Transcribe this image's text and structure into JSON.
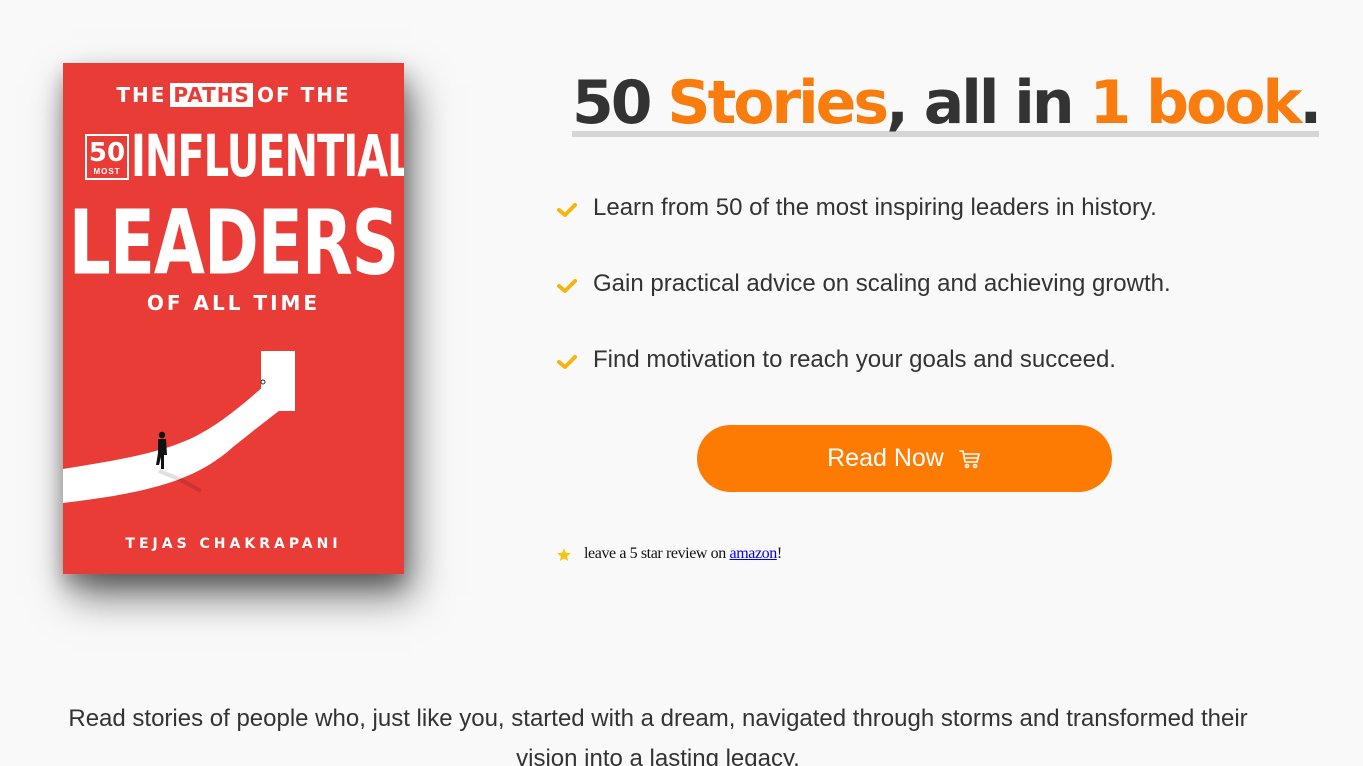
{
  "book": {
    "top_line_pre": "THE",
    "top_line_highlight": "PATHS",
    "top_line_post": "OF THE",
    "number": "50",
    "number_sub": "MOST",
    "line_influential": "INFLUENTIAL",
    "line_leaders": "LEADERS",
    "line_all_time": "OF ALL TIME",
    "author": "TEJAS CHAKRAPANI"
  },
  "headline": {
    "part1": "50 ",
    "part2": "Stories",
    "part3": ", all in ",
    "part4": "1 book",
    "part5": "."
  },
  "bullets": [
    {
      "text": "Learn from 50 of the most inspiring leaders in history."
    },
    {
      "text": "Gain practical advice on scaling and achieving growth."
    },
    {
      "text": "Find motivation to reach your goals and succeed."
    }
  ],
  "cta": {
    "label": "Read Now"
  },
  "review": {
    "pre": "leave a 5 star review on ",
    "link": "amazon",
    "post": "!"
  },
  "bottom": {
    "text": "Read stories of people who, just like you, started with a dream, navigated through storms and transformed their vision into a lasting legacy."
  },
  "colors": {
    "accent": "#f87c0e",
    "button": "#fd7a03",
    "check": "#f6b40e",
    "cover": "#e93c37"
  },
  "icons": {
    "bullet": "check-icon",
    "button": "cart-icon",
    "review": "star-icon"
  }
}
